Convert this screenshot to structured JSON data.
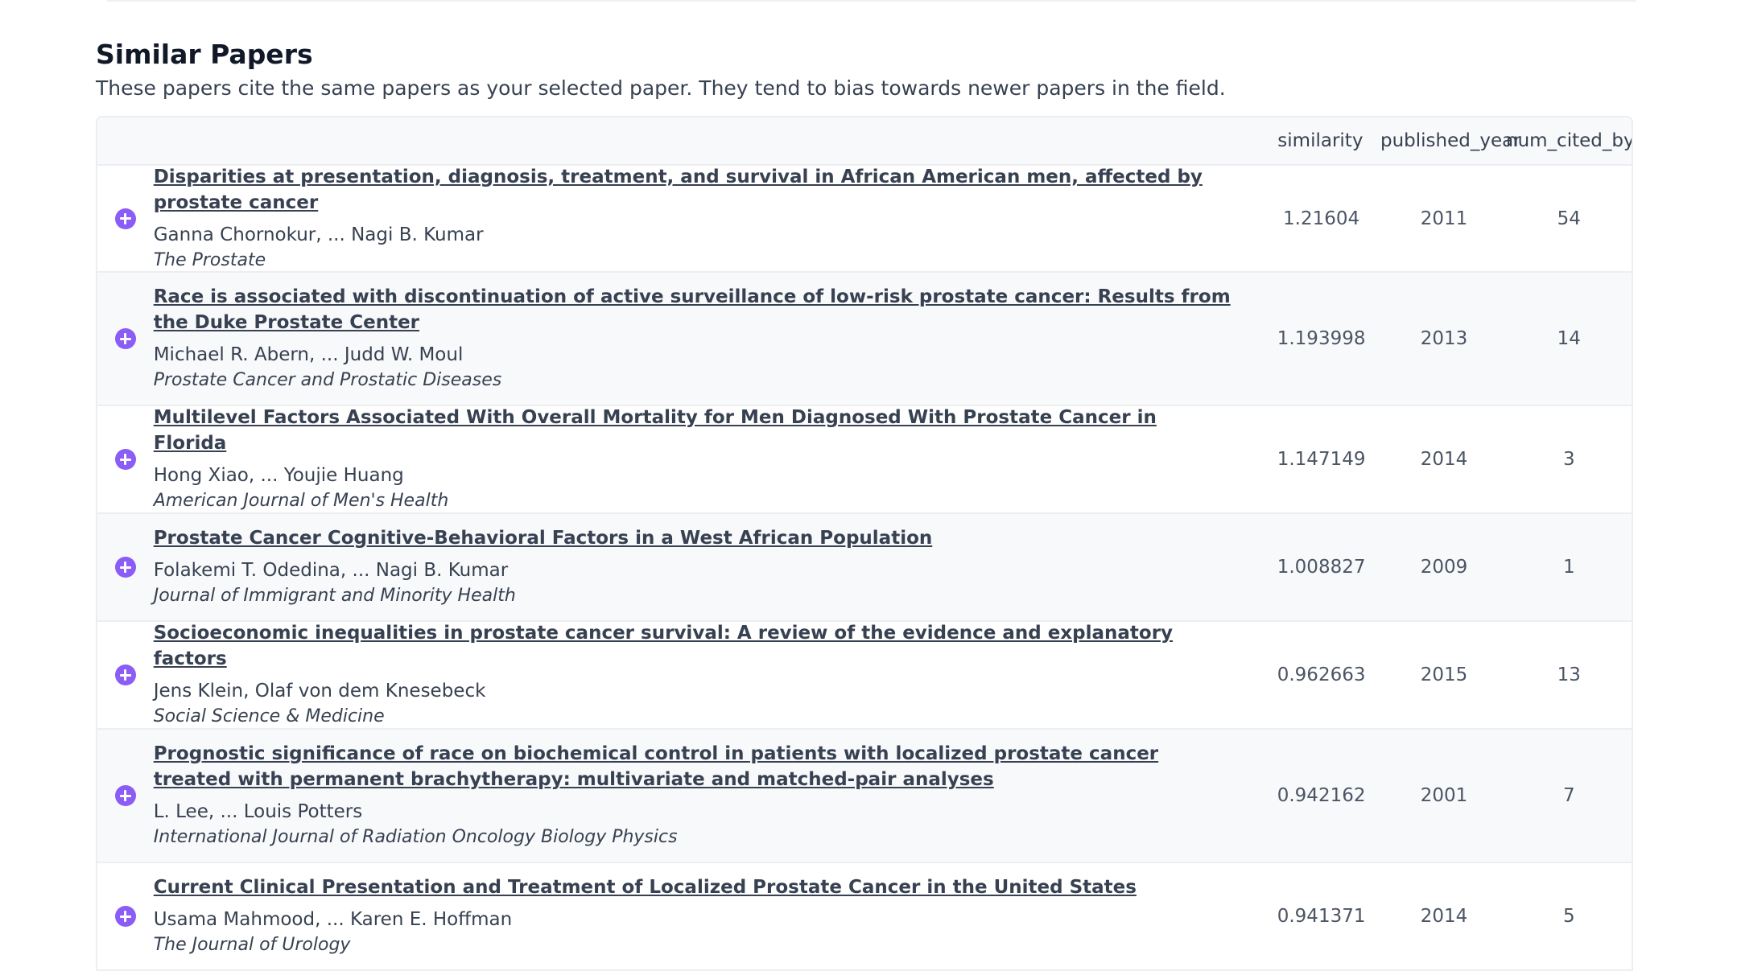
{
  "section": {
    "title": "Similar Papers",
    "subtitle": "These papers cite the same papers as your selected paper. They tend to bias towards newer papers in the field."
  },
  "table": {
    "columns": [
      "similarity",
      "published_year",
      "num_cited_by"
    ],
    "rows": [
      {
        "title": "Disparities at presentation, diagnosis, treatment, and survival in African American men, affected by prostate cancer",
        "authors": "Ganna Chornokur, ... Nagi B. Kumar",
        "venue": "The Prostate",
        "similarity": "1.21604",
        "published_year": "2011",
        "num_cited_by": "54"
      },
      {
        "title": "Race is associated with discontinuation of active surveillance of low-risk prostate cancer: Results from the Duke Prostate Center",
        "authors": "Michael R. Abern, ... Judd W. Moul",
        "venue": "Prostate Cancer and Prostatic Diseases",
        "similarity": "1.193998",
        "published_year": "2013",
        "num_cited_by": "14"
      },
      {
        "title": "Multilevel Factors Associated With Overall Mortality for Men Diagnosed With Prostate Cancer in Florida",
        "authors": "Hong Xiao, ... Youjie Huang",
        "venue": "American Journal of Men's Health",
        "similarity": "1.147149",
        "published_year": "2014",
        "num_cited_by": "3"
      },
      {
        "title": "Prostate Cancer Cognitive-Behavioral Factors in a West African Population",
        "authors": "Folakemi T. Odedina, ... Nagi B. Kumar",
        "venue": "Journal of Immigrant and Minority Health",
        "similarity": "1.008827",
        "published_year": "2009",
        "num_cited_by": "1"
      },
      {
        "title": "Socioeconomic inequalities in prostate cancer survival: A review of the evidence and explanatory factors",
        "authors": "Jens Klein, Olaf von dem Knesebeck",
        "venue": "Social Science & Medicine",
        "similarity": "0.962663",
        "published_year": "2015",
        "num_cited_by": "13"
      },
      {
        "title": "Prognostic significance of race on biochemical control in patients with localized prostate cancer treated with permanent brachytherapy: multivariate and matched-pair analyses",
        "authors": "L. Lee, ... Louis Potters",
        "venue": "International Journal of Radiation Oncology Biology Physics",
        "similarity": "0.942162",
        "published_year": "2001",
        "num_cited_by": "7"
      },
      {
        "title": "Current Clinical Presentation and Treatment of Localized Prostate Cancer in the United States",
        "authors": "Usama Mahmood, ... Karen E. Hoffman",
        "venue": "The Journal of Urology",
        "similarity": "0.941371",
        "published_year": "2014",
        "num_cited_by": "5"
      }
    ]
  },
  "colors": {
    "accent": "#8b5cf6",
    "row_alt": "#f8f9fb",
    "border": "#eceef2"
  }
}
